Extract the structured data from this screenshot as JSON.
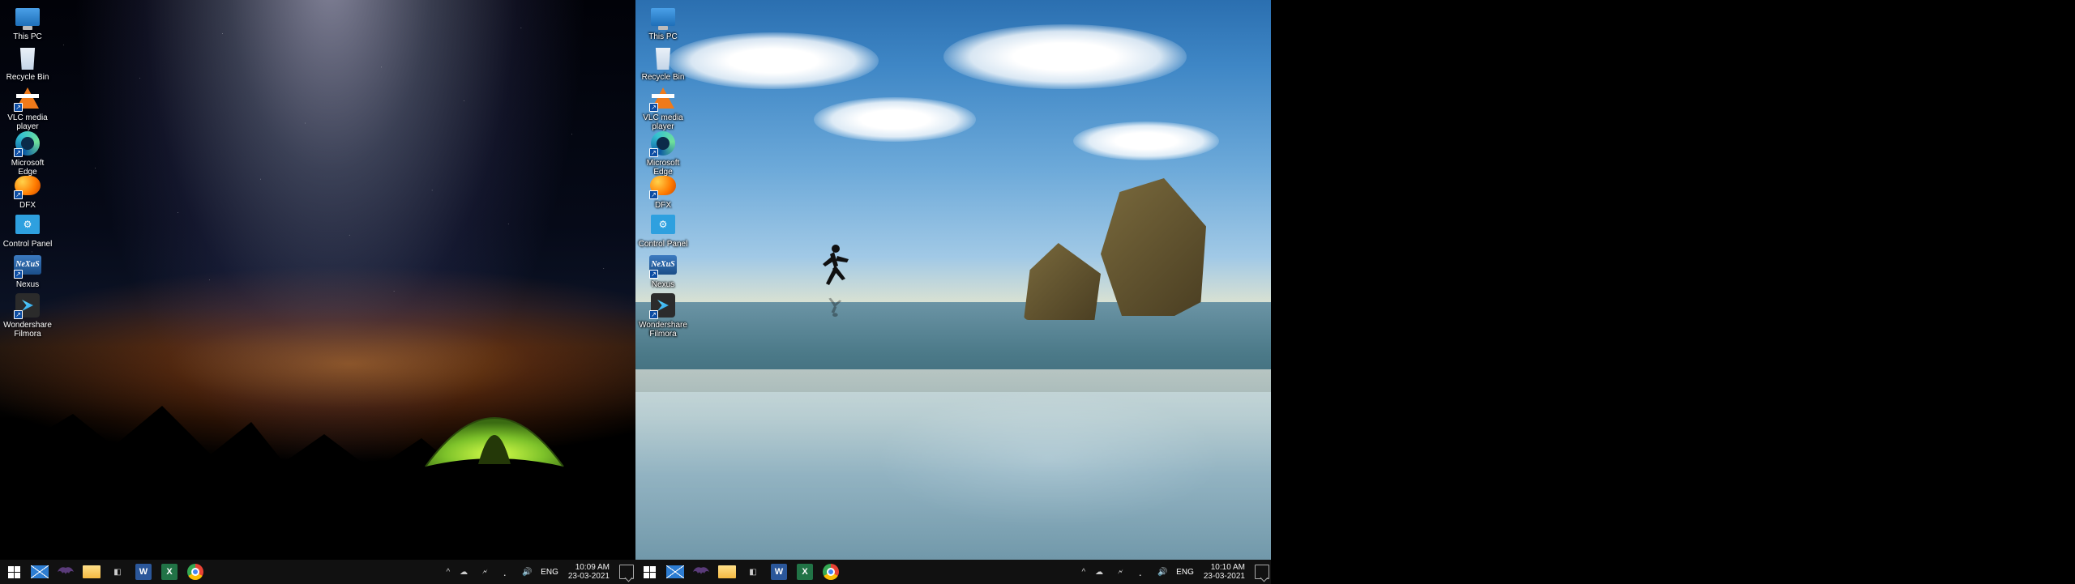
{
  "icons": [
    {
      "key": "thispc",
      "label": "This PC"
    },
    {
      "key": "recycle",
      "label": "Recycle Bin"
    },
    {
      "key": "vlc",
      "label": "VLC media player"
    },
    {
      "key": "edge",
      "label": "Microsoft Edge"
    },
    {
      "key": "dfx",
      "label": "DFX"
    },
    {
      "key": "cpl",
      "label": "Control Panel"
    },
    {
      "key": "nexus",
      "label": "Nexus"
    },
    {
      "key": "filmora",
      "label": "Wondershare Filmora"
    }
  ],
  "nexus_text": "NeXuS",
  "word_letter": "W",
  "excel_letter": "X",
  "cpl_glyph": "⚙",
  "tray": {
    "lang": "ENG",
    "chevron": "^",
    "onedrive": "☁",
    "wifi": "⡀",
    "sound": "🔊",
    "battery": "🗲"
  },
  "left": {
    "time": "10:09 AM",
    "date": "23-03-2021"
  },
  "right": {
    "time": "10:10 AM",
    "date": "23-03-2021"
  }
}
